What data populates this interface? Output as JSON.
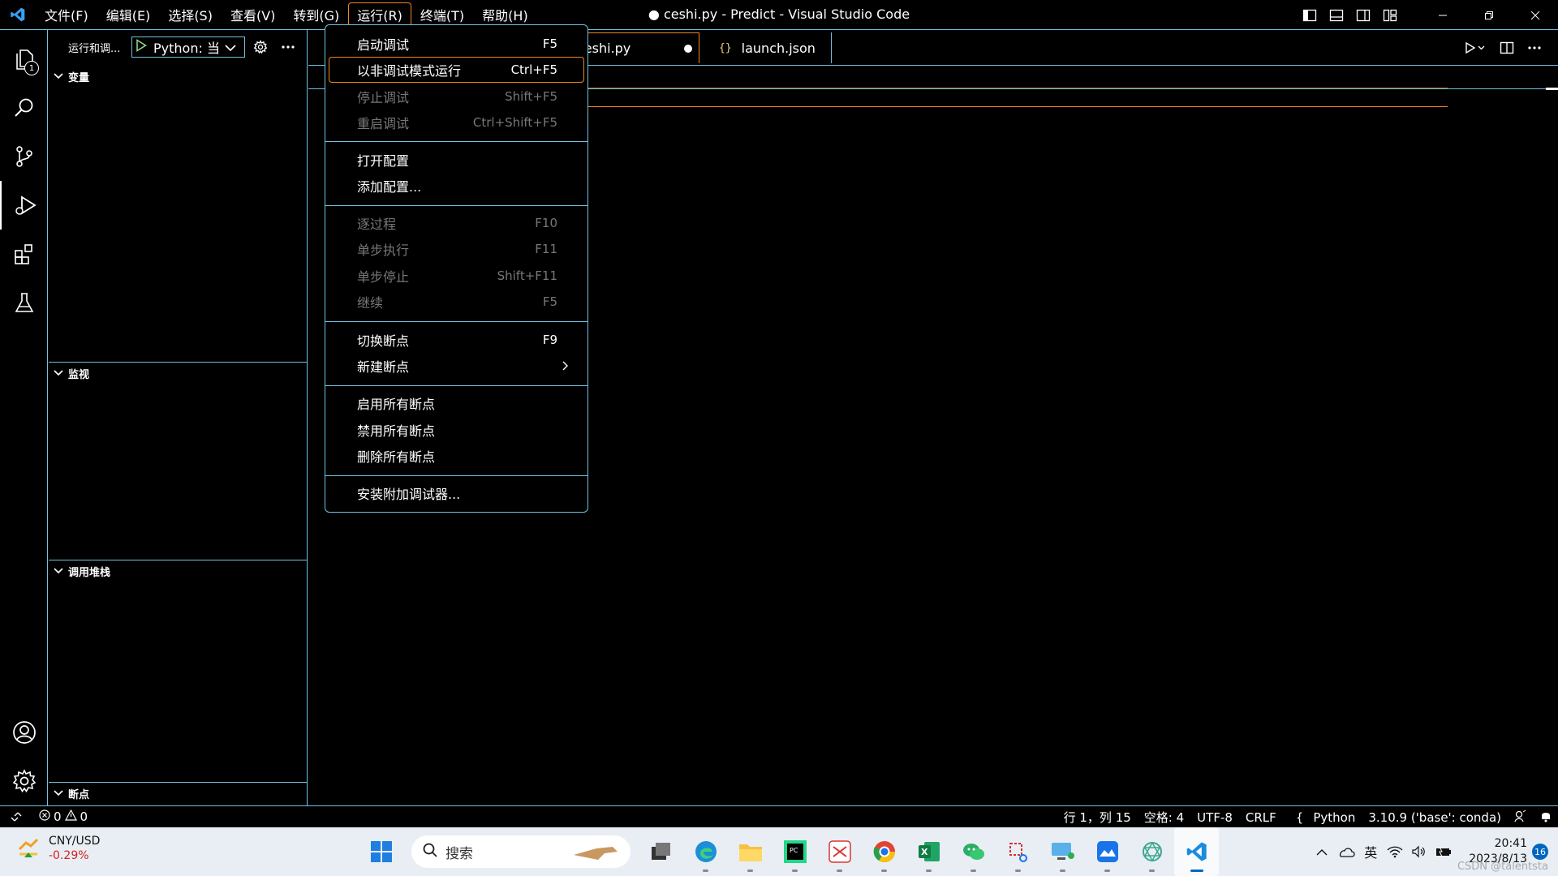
{
  "titlebar": {
    "menus": [
      "文件(F)",
      "编辑(E)",
      "选择(S)",
      "查看(V)",
      "转到(G)",
      "运行(R)",
      "终端(T)",
      "帮助(H)"
    ],
    "window_title": "● ceshi.py - Predict - Visual Studio Code"
  },
  "activitybar": {
    "explorer_badge": "1",
    "items": [
      "explorer",
      "search",
      "source-control",
      "run-and-debug",
      "extensions",
      "testing",
      "accounts",
      "manage"
    ]
  },
  "sidebar": {
    "title": "运行和调...",
    "config": "Python: 当",
    "sections": {
      "variables": "变量",
      "watch": "监视",
      "callstack": "调用堆栈",
      "breakpoints": "断点"
    }
  },
  "tabs": [
    {
      "label": "ceshi.py",
      "dirty": true
    },
    {
      "label": "launch.json",
      "icon": "{}"
    }
  ],
  "run_menu": {
    "start_debugging": {
      "label": "启动调试",
      "key": "F5"
    },
    "run_without_debugging": {
      "label": "以非调试模式运行",
      "key": "Ctrl+F5"
    },
    "stop_debugging": {
      "label": "停止调试",
      "key": "Shift+F5"
    },
    "restart_debugging": {
      "label": "重启调试",
      "key": "Ctrl+Shift+F5"
    },
    "open_config": {
      "label": "打开配置"
    },
    "add_config": {
      "label": "添加配置..."
    },
    "step_over": {
      "label": "逐过程",
      "key": "F10"
    },
    "step_into": {
      "label": "单步执行",
      "key": "F11"
    },
    "step_out": {
      "label": "单步停止",
      "key": "Shift+F11"
    },
    "continue": {
      "label": "继续",
      "key": "F5"
    },
    "toggle_breakpoint": {
      "label": "切换断点",
      "key": "F9"
    },
    "new_breakpoint": {
      "label": "新建断点"
    },
    "enable_all_breakpoints": {
      "label": "启用所有断点"
    },
    "disable_all_breakpoints": {
      "label": "禁用所有断点"
    },
    "remove_all_breakpoints": {
      "label": "删除所有断点"
    },
    "install_debuggers": {
      "label": "安装附加调试器..."
    }
  },
  "statusbar": {
    "errors": "0",
    "warnings": "0",
    "position": "行 1，列 15",
    "spaces": "空格: 4",
    "encoding": "UTF-8",
    "eol": "CRLF",
    "language": "Python",
    "interpreter": "3.10.9 ('base': conda)"
  },
  "taskbar": {
    "ticker": "CNY/USD",
    "ticker_change": "-0.29%",
    "search_placeholder": "搜索",
    "ime": "英",
    "time": "20:41",
    "date": "2023/8/13",
    "notifications": "16",
    "watermark": "CSDN @talentsta"
  },
  "colors": {
    "contrast_border": "#6fc3df",
    "active_border": "#f38518"
  }
}
